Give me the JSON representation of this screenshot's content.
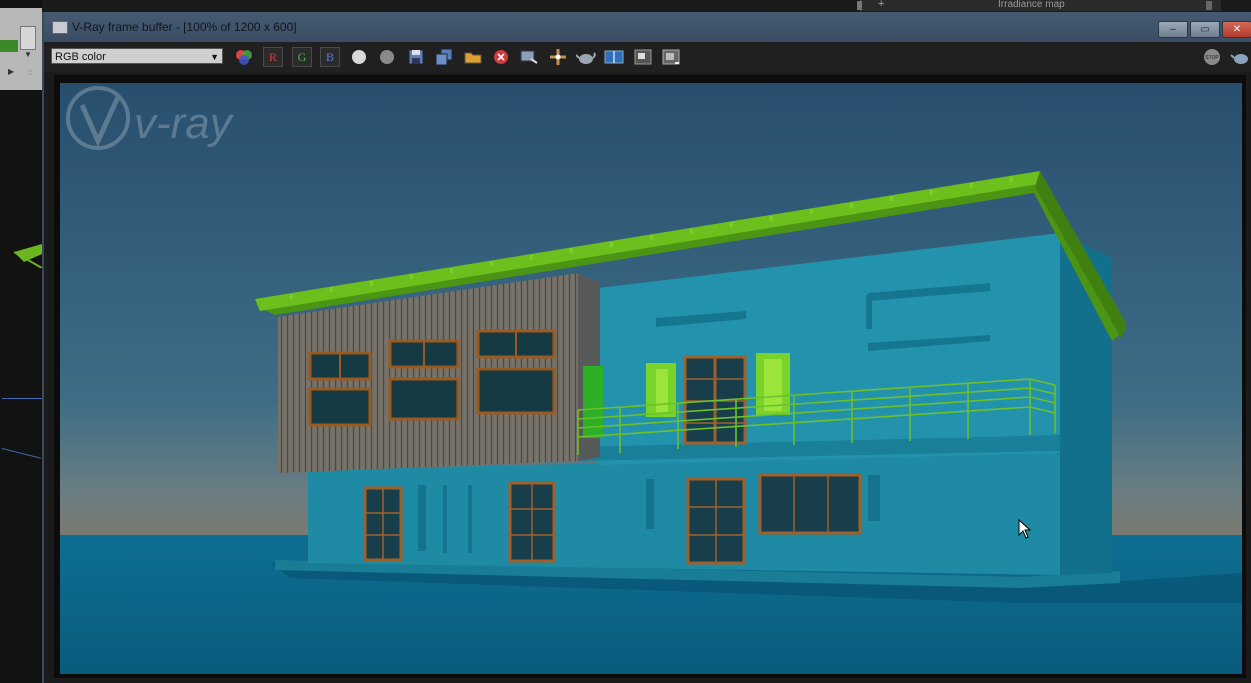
{
  "background_app": {
    "panel_label": "Irradiance map",
    "plus_glyph": "+"
  },
  "window": {
    "title": "V-Ray frame buffer - [100% of 1200 x 600]",
    "controls": {
      "minimize": "–",
      "maximize": "▭",
      "close": "✕"
    }
  },
  "toolbar": {
    "channel_select": "RGB color",
    "channel_buttons": [
      "R",
      "G",
      "B"
    ]
  },
  "render": {
    "watermark": "v-ray",
    "sky_color": "#2e5878",
    "ground_color": "#0d6a8c",
    "roof_color": "#5faa18",
    "wall_color": "#1e8ca0"
  },
  "colors": {
    "titlebar": "#465a71",
    "close_button": "#c44a3a"
  }
}
